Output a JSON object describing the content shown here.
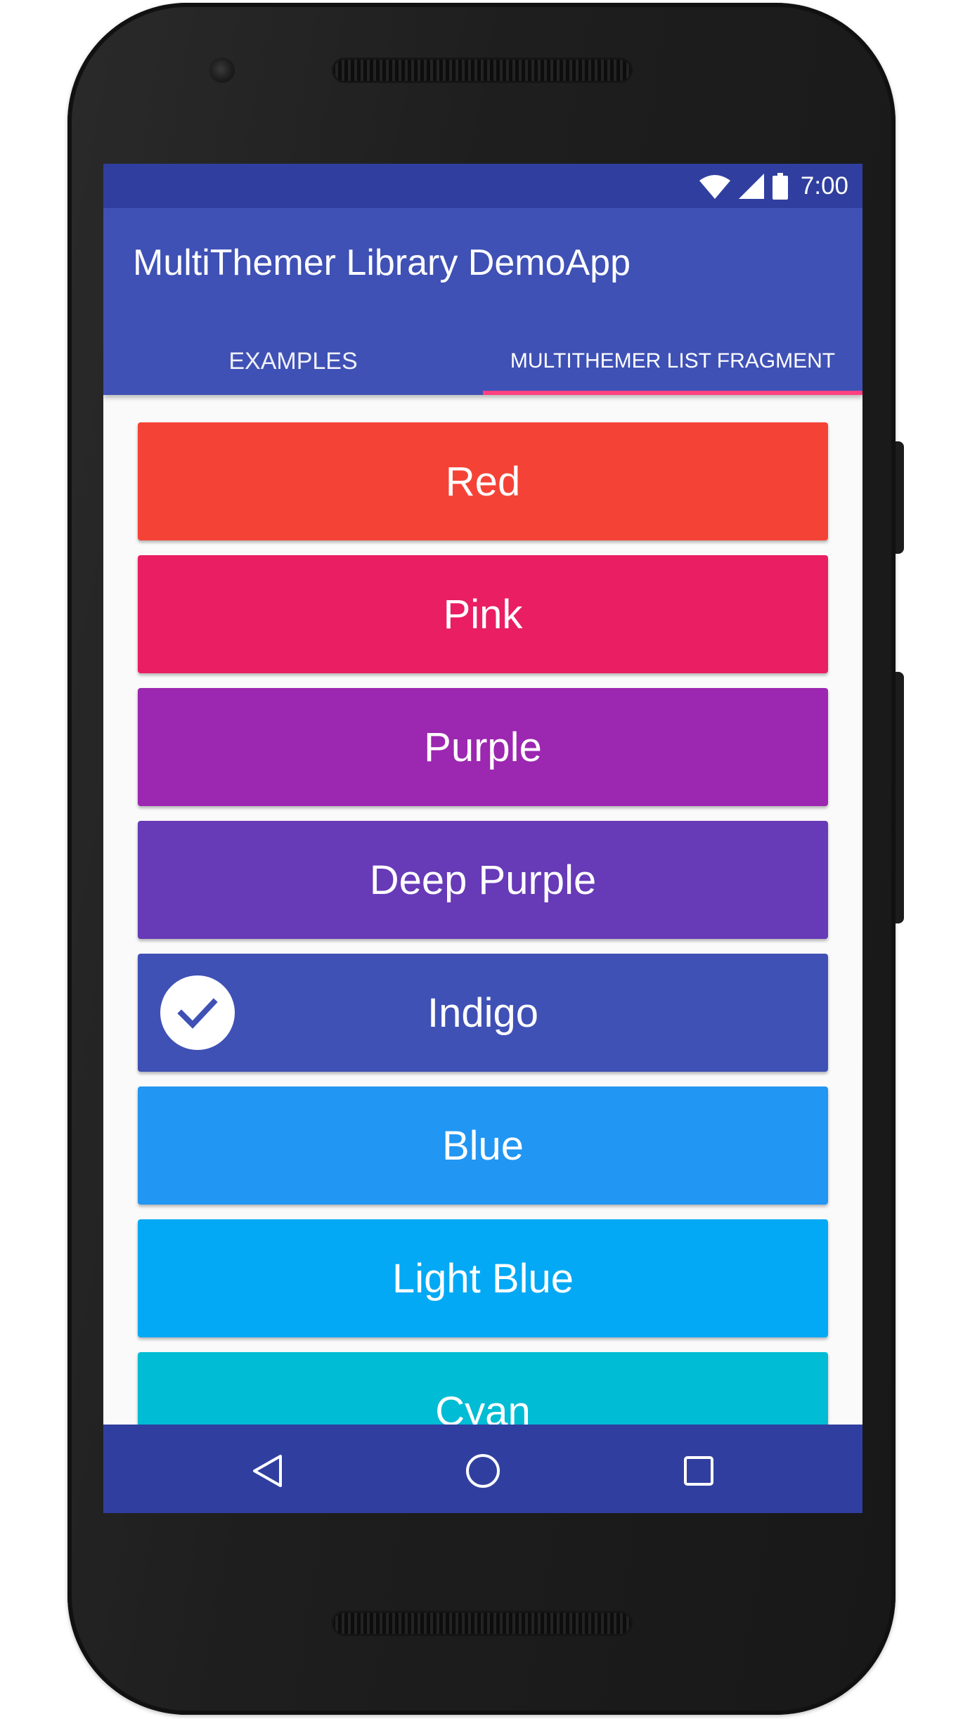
{
  "statusbar": {
    "time": "7:00",
    "icons": [
      "wifi-icon",
      "cell-signal-icon",
      "battery-icon"
    ]
  },
  "appbar": {
    "title": "MultiThemer Library DemoApp"
  },
  "tabs": [
    {
      "label": "EXAMPLES",
      "selected": false
    },
    {
      "label": "MULTITHEMER LIST FRAGMENT",
      "selected": true
    }
  ],
  "themes": [
    {
      "label": "Red",
      "color": "#F44336",
      "selected": false
    },
    {
      "label": "Pink",
      "color": "#E91E63",
      "selected": false
    },
    {
      "label": "Purple",
      "color": "#9C27B0",
      "selected": false
    },
    {
      "label": "Deep Purple",
      "color": "#673AB7",
      "selected": false
    },
    {
      "label": "Indigo",
      "color": "#3F51B5",
      "selected": true
    },
    {
      "label": "Blue",
      "color": "#2196F3",
      "selected": false
    },
    {
      "label": "Light Blue",
      "color": "#03A9F4",
      "selected": false
    },
    {
      "label": "Cyan",
      "color": "#00BCD4",
      "selected": false
    }
  ],
  "navbar": {
    "icons": [
      "back-icon",
      "home-icon",
      "recents-icon"
    ]
  },
  "colors": {
    "primary": "#3F51B5",
    "primary_dark": "#303F9F",
    "accent": "#FF4081"
  }
}
